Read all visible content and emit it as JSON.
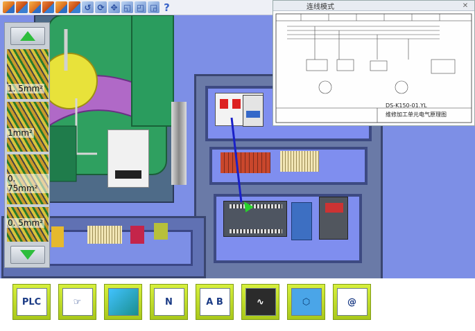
{
  "toolbar": {
    "icons": [
      "cube-view-1",
      "cube-view-2",
      "cube-view-3",
      "cube-view-4",
      "cube-view-5",
      "cube-view-6",
      "rotate-tool",
      "orbit-tool",
      "pan-tool",
      "zoom-tool",
      "zoom-fit-tool",
      "select-tool",
      "help"
    ],
    "help_label": "?"
  },
  "wire_selector": {
    "options": [
      "1. 5mm²",
      "1mm²",
      "0. 75mm²",
      "0. 5mm²"
    ]
  },
  "schematic_window": {
    "title": "连线模式",
    "close_label": "✕",
    "drawing_no": "DS-K150-01.YL",
    "drawing_caption": "维修加工单元电气原理图",
    "column_headers": [
      "变压电",
      "变频器",
      "PLC",
      "单相电",
      "三相电",
      "步进驱动器",
      "伺服电机"
    ]
  },
  "bottom_toolbar": {
    "buttons": [
      {
        "name": "plc-button",
        "label": "PLC"
      },
      {
        "name": "touch-screen-button",
        "label": ""
      },
      {
        "name": "cube-move-button",
        "label": ""
      },
      {
        "name": "circuit-switch-button",
        "label": "N"
      },
      {
        "name": "ab-wiring-button",
        "label": "A  B"
      },
      {
        "name": "oscilloscope-button",
        "label": ""
      },
      {
        "name": "hex-nut-button",
        "label": ""
      },
      {
        "name": "search-button",
        "label": "@"
      }
    ]
  },
  "colors": {
    "scene_background": "#7d8fe6",
    "button_green": "#b8d62a",
    "arrow_green": "#2ebd3c"
  }
}
